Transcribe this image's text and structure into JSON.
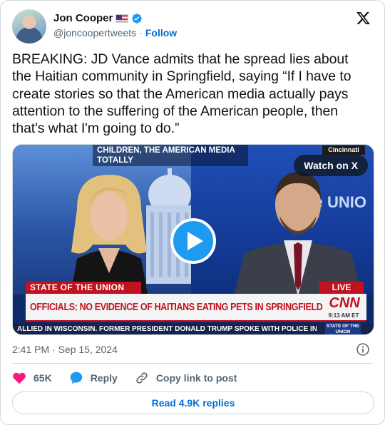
{
  "author": {
    "display_name": "Jon Cooper",
    "handle": "@joncoopertweets",
    "separator": "·",
    "follow_label": "Follow",
    "verified_color": "#1d9bf0",
    "flag_icon": "us-flag-icon"
  },
  "tweet": {
    "text": "BREAKING: JD Vance admits that he spread lies about the Haitian community in Springfield, saying “If I have to create stories so that the American media actually pays attention to the suffering of the American people, then that's what I'm going to do.”",
    "timestamp": "2:41 PM · Sep 15, 2024"
  },
  "media": {
    "watch_label": "Watch on X",
    "top_ticker": "CHILDREN, THE AMERICAN MEDIA TOTALLY",
    "city_badge": "Cincinnati",
    "show_label": "STATE OF THE UNION",
    "live_label": "LIVE",
    "headline": "OFFICIALS: NO EVIDENCE OF HAITIANS EATING PETS IN SPRINGFIELD",
    "network_logo": "CNN",
    "clock": "9:13 AM ET",
    "crawl": "ALLIED IN WISCONSIN. FORMER PRESIDENT DONALD TRUMP SPOKE WITH POLICE IN L",
    "crawl_badge": "STATE OF THE UNION",
    "set_logo": "State UNIO",
    "accent_color": "#c1121f"
  },
  "actions": {
    "like_count": "65K",
    "reply_label": "Reply",
    "copy_label": "Copy link to post",
    "read_replies_label": "Read 4.9K replies",
    "like_color": "#f91880",
    "reply_color": "#1d9bf0"
  }
}
